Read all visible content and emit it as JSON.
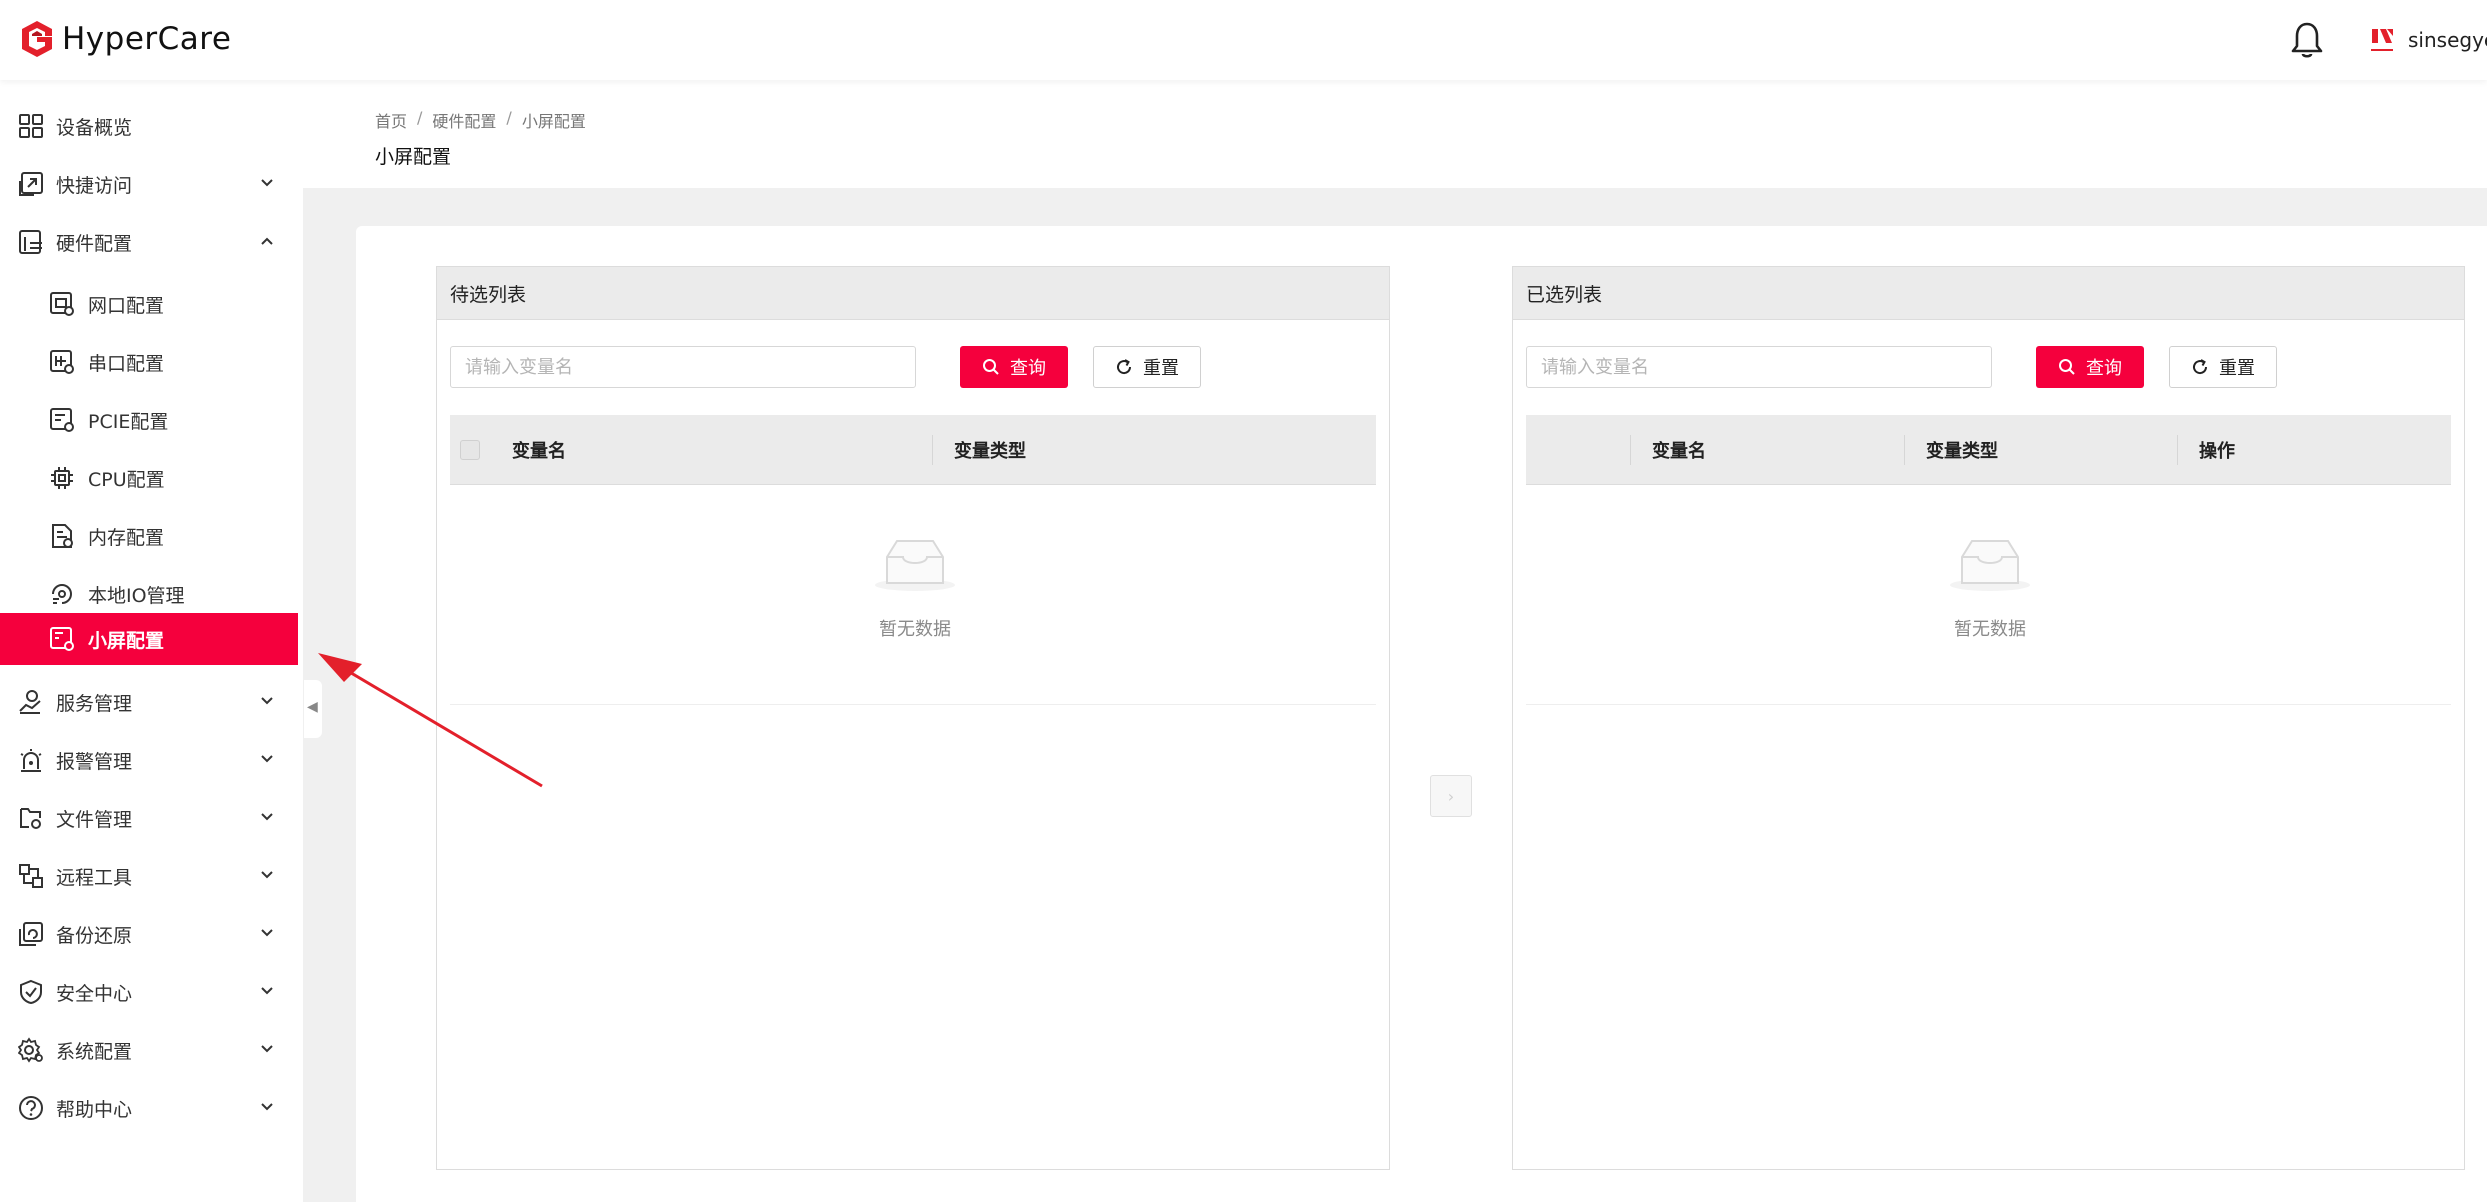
{
  "app": {
    "name": "HyperCare",
    "user": "sinsegye"
  },
  "colors": {
    "accent": "#f5003d",
    "annotation": "#e3202b"
  },
  "sidebar": {
    "items": [
      {
        "label": "设备概览",
        "icon": "grid-icon"
      },
      {
        "label": "快捷访问",
        "icon": "shortcut-icon"
      },
      {
        "label": "硬件配置",
        "icon": "hardware-icon"
      },
      {
        "label": "网口配置",
        "icon": "network-port-icon"
      },
      {
        "label": "串口配置",
        "icon": "serial-port-icon"
      },
      {
        "label": "PCIE配置",
        "icon": "pcie-icon"
      },
      {
        "label": "CPU配置",
        "icon": "cpu-icon"
      },
      {
        "label": "内存配置",
        "icon": "memory-icon"
      },
      {
        "label": "本地IO管理",
        "icon": "io-icon"
      },
      {
        "label": "小屏配置",
        "icon": "screen-icon",
        "active": true
      },
      {
        "label": "服务管理",
        "icon": "service-icon"
      },
      {
        "label": "报警管理",
        "icon": "alarm-icon"
      },
      {
        "label": "文件管理",
        "icon": "file-icon"
      },
      {
        "label": "远程工具",
        "icon": "remote-icon"
      },
      {
        "label": "备份还原",
        "icon": "backup-icon"
      },
      {
        "label": "安全中心",
        "icon": "shield-icon"
      },
      {
        "label": "系统配置",
        "icon": "settings-icon"
      },
      {
        "label": "帮助中心",
        "icon": "help-icon"
      }
    ]
  },
  "breadcrumb": {
    "items": [
      "首页",
      "硬件配置",
      "小屏配置"
    ],
    "separator": "/"
  },
  "page": {
    "title": "小屏配置"
  },
  "left_panel": {
    "title": "待选列表",
    "search_placeholder": "请输入变量名",
    "query_label": "查询",
    "reset_label": "重置",
    "columns": [
      "变量名",
      "变量类型"
    ],
    "empty_text": "暂无数据"
  },
  "right_panel": {
    "title": "已选列表",
    "search_placeholder": "请输入变量名",
    "query_label": "查询",
    "reset_label": "重置",
    "columns": [
      "变量名",
      "变量类型",
      "操作"
    ],
    "empty_text": "暂无数据"
  },
  "transfer": {
    "icon": "chevron-right-icon",
    "symbol": "›"
  },
  "collapse_handle": {
    "symbol": "◀"
  }
}
